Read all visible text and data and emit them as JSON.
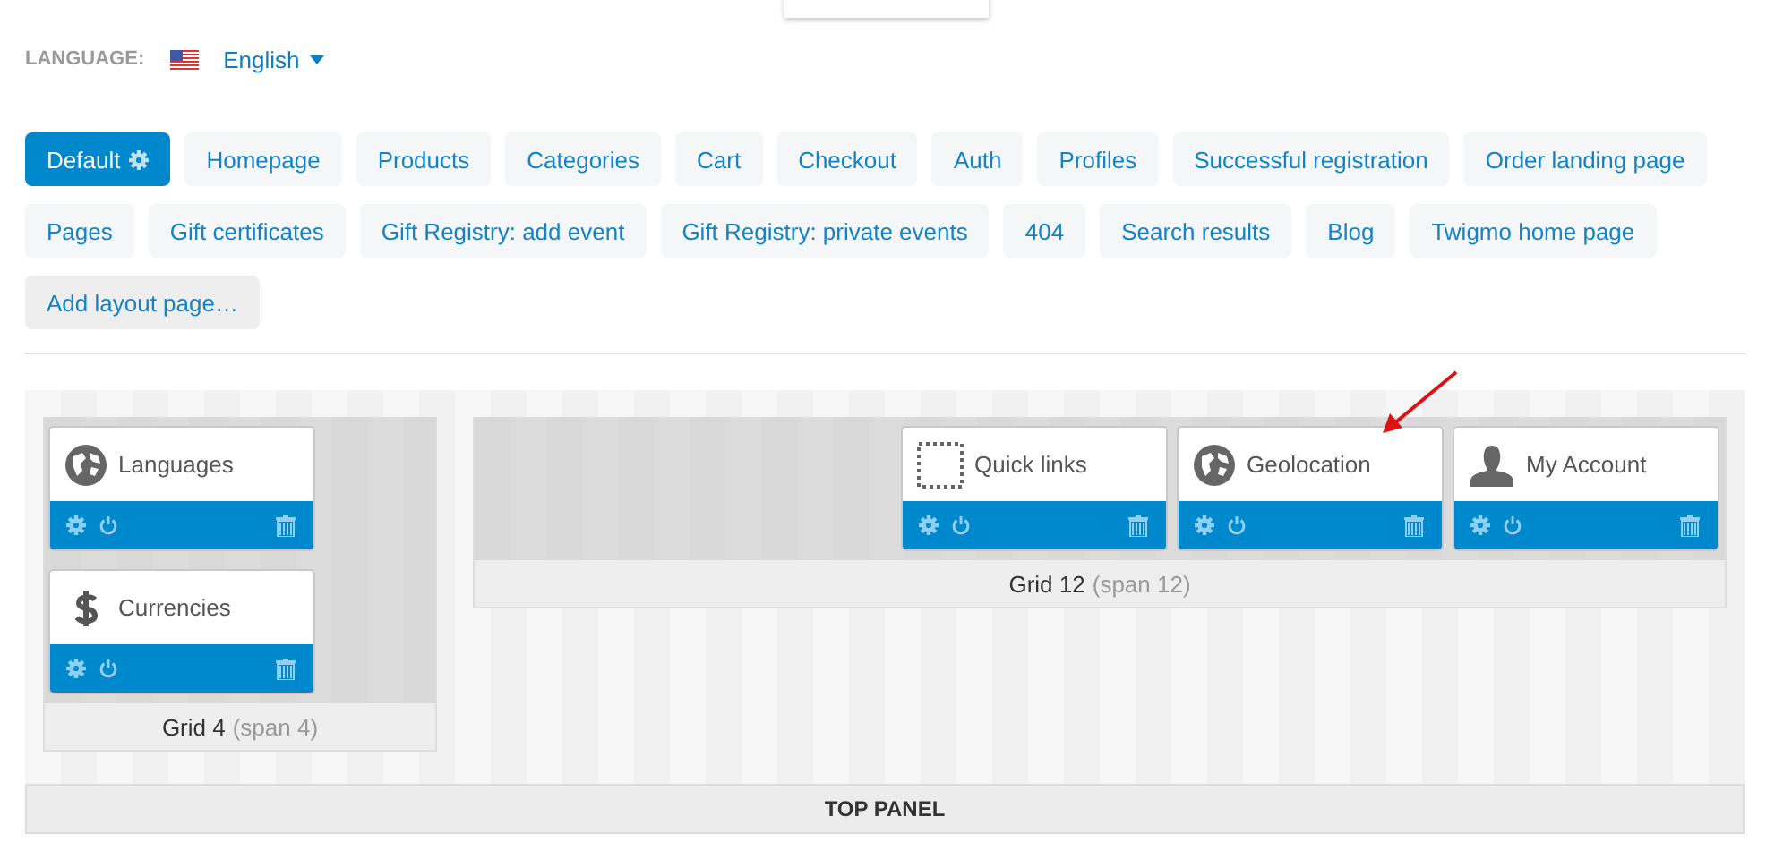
{
  "language": {
    "label": "LANGUAGE:",
    "value": "English"
  },
  "layout_tabs": [
    {
      "label": "Default",
      "selected": true
    },
    {
      "label": "Homepage",
      "selected": false
    },
    {
      "label": "Products",
      "selected": false
    },
    {
      "label": "Categories",
      "selected": false
    },
    {
      "label": "Cart",
      "selected": false
    },
    {
      "label": "Checkout",
      "selected": false
    },
    {
      "label": "Auth",
      "selected": false
    },
    {
      "label": "Profiles",
      "selected": false
    },
    {
      "label": "Successful registration",
      "selected": false
    },
    {
      "label": "Order landing page",
      "selected": false
    },
    {
      "label": "Pages",
      "selected": false
    },
    {
      "label": "Gift certificates",
      "selected": false
    },
    {
      "label": "Gift Registry: add event",
      "selected": false
    },
    {
      "label": "Gift Registry: private events",
      "selected": false
    },
    {
      "label": "404",
      "selected": false
    },
    {
      "label": "Search results",
      "selected": false
    },
    {
      "label": "Blog",
      "selected": false
    },
    {
      "label": "Twigmo home page",
      "selected": false
    }
  ],
  "add_layout_button": "Add layout page…",
  "grids": [
    {
      "kind": "column",
      "title": "Grid 4",
      "span": "(span 4)",
      "blocks": [
        {
          "name": "Languages",
          "kind": "globe"
        },
        {
          "name": "Currencies",
          "kind": "dollar"
        }
      ]
    },
    {
      "kind": "row",
      "title": "Grid 12",
      "span": "(span 12)",
      "blocks": [
        {
          "name": "Quick links",
          "kind": "dashed"
        },
        {
          "name": "Geolocation",
          "kind": "globe"
        },
        {
          "name": "My Account",
          "kind": "user"
        }
      ]
    }
  ],
  "panel": {
    "title": "TOP PANEL"
  }
}
